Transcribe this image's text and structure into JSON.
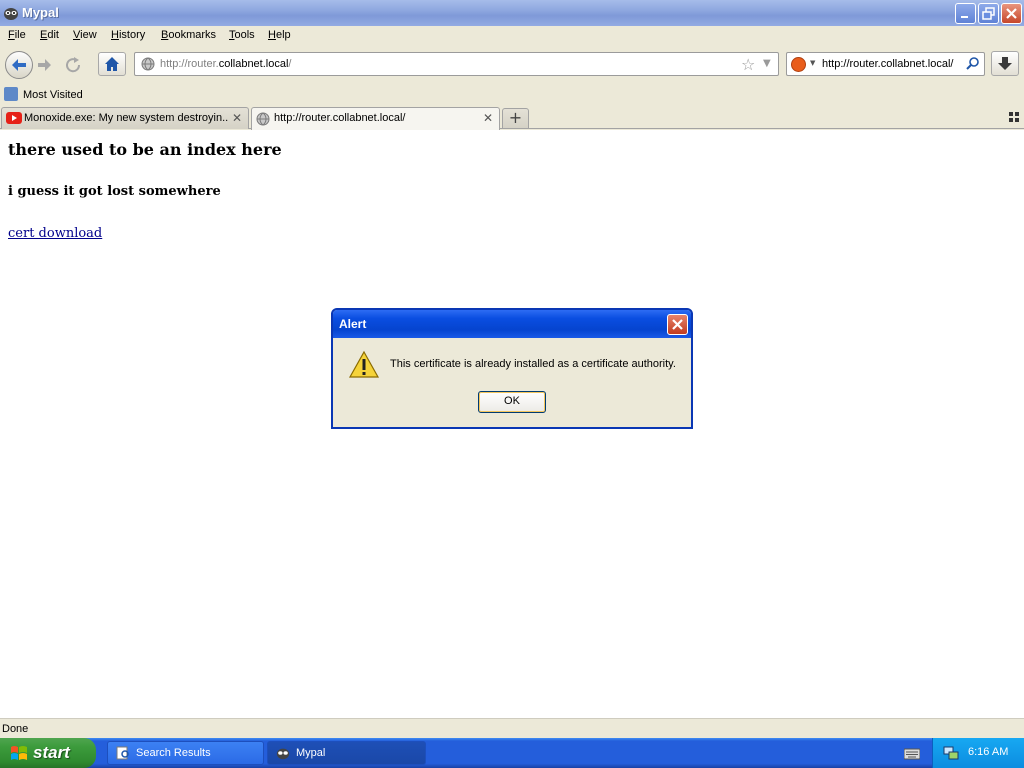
{
  "window": {
    "title": "Mypal",
    "icon": "mypal-icon"
  },
  "menu": [
    "File",
    "Edit",
    "View",
    "History",
    "Bookmarks",
    "Tools",
    "Help"
  ],
  "navbar": {
    "url_prefix": "http://router.",
    "url_host": "collabnet.local",
    "url_suffix": "/",
    "search_text": "http://router.collabnet.local/"
  },
  "bookmarks": {
    "most_visited": "Most Visited"
  },
  "tabs": [
    {
      "label": "Monoxide.exe: My new system destroyin...",
      "icon": "youtube-icon",
      "active": false
    },
    {
      "label": "http://router.collabnet.local/",
      "icon": "globe-icon",
      "active": true
    }
  ],
  "page": {
    "heading": "there used to be an index here",
    "subheading": "i guess it got lost somewhere",
    "link": "cert download"
  },
  "status": "Done",
  "dialog": {
    "title": "Alert",
    "message": "This certificate is already installed as a certificate authority.",
    "ok_label": "OK"
  },
  "taskbar": {
    "start_label": "start",
    "items": [
      {
        "label": "Search Results",
        "active": false
      },
      {
        "label": "Mypal",
        "active": true
      }
    ],
    "clock": "6:16 AM"
  },
  "colors": {
    "link": "#00008b",
    "dialog_title": "#0a4ee1",
    "taskbar": "#245edb",
    "start": "#3c9b3c"
  }
}
